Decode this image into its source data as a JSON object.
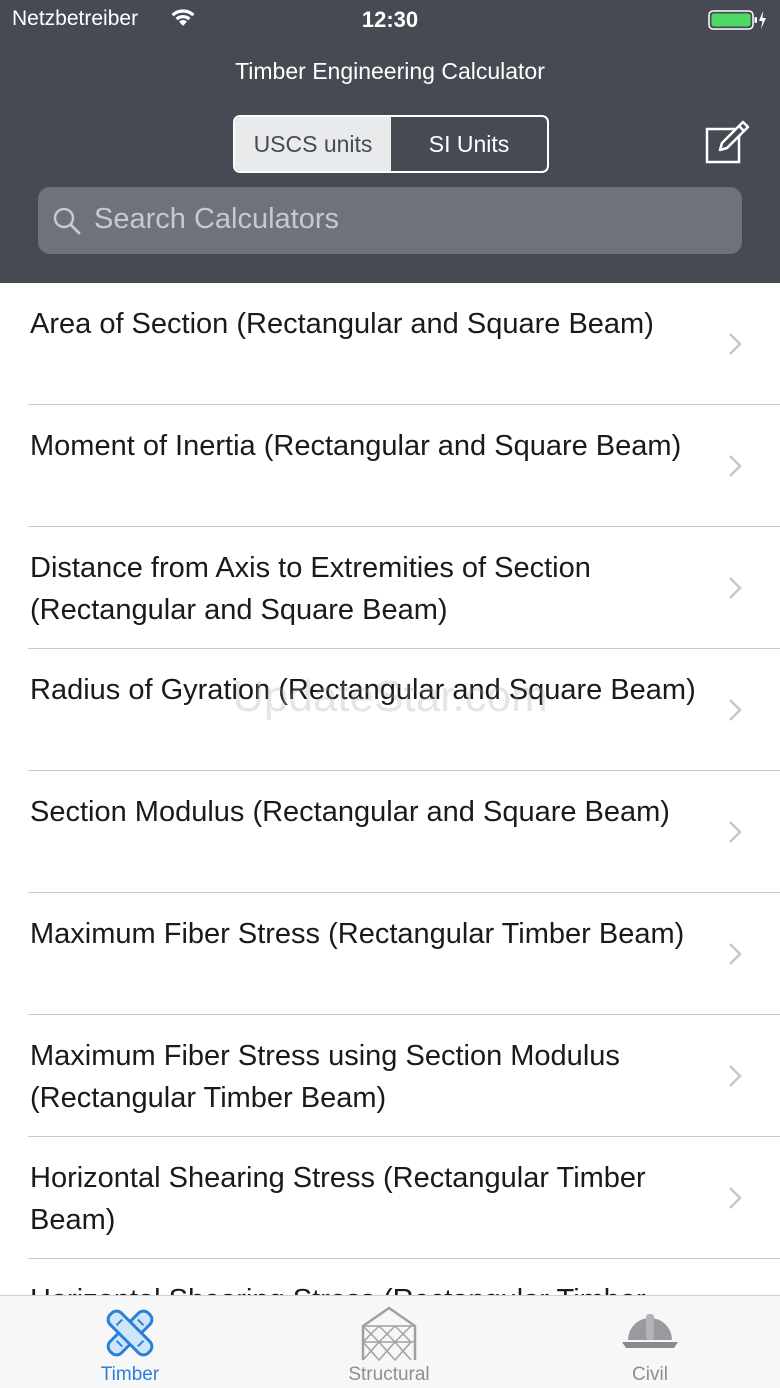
{
  "status_bar": {
    "carrier": "Netzbetreiber",
    "time": "12:30"
  },
  "nav": {
    "title": "Timber Engineering Calculator"
  },
  "units": {
    "options": [
      "USCS units",
      "SI Units"
    ],
    "selected": "USCS units"
  },
  "search": {
    "placeholder": "Search Calculators"
  },
  "list": {
    "items": [
      {
        "label": "Area of Section (Rectangular and Square Beam)"
      },
      {
        "label": "Moment of Inertia (Rectangular and Square Beam)"
      },
      {
        "label": "Distance from Axis to Extremities of Section (Rectangular and Square Beam)"
      },
      {
        "label": "Radius of Gyration (Rectangular and Square Beam)"
      },
      {
        "label": "Section Modulus (Rectangular and Square Beam)"
      },
      {
        "label": "Maximum Fiber Stress (Rectangular Timber Beam)"
      },
      {
        "label": "Maximum Fiber Stress using Section Modulus (Rectangular Timber Beam)"
      },
      {
        "label": "Horizontal Shearing Stress (Rectangular Timber Beam)"
      },
      {
        "label": "Horizontal Shearing Stress (Rectangular Timber Beam)"
      }
    ]
  },
  "watermark": "UpdateStar.com",
  "tabbar": {
    "tabs": [
      {
        "label": "Timber",
        "icon": "timber-icon",
        "active": true
      },
      {
        "label": "Structural",
        "icon": "structural-icon",
        "active": false
      },
      {
        "label": "Civil",
        "icon": "hardhat-icon",
        "active": false
      }
    ]
  },
  "colors": {
    "header": "#464a53",
    "accent": "#2a7fd6",
    "battery": "#4cd964"
  }
}
